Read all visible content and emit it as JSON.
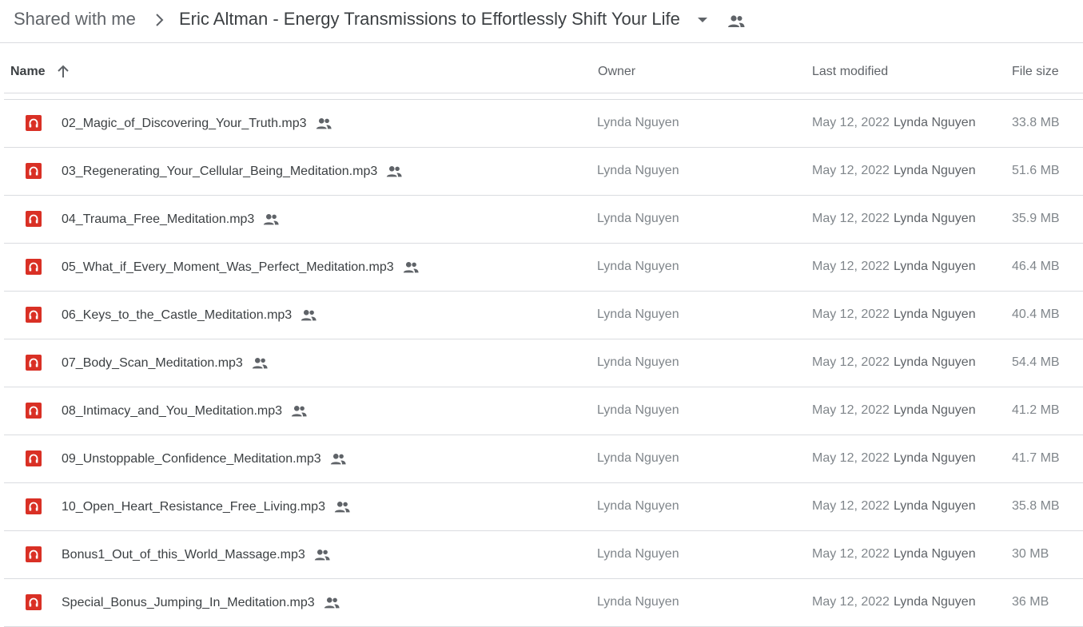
{
  "breadcrumb": {
    "root": "Shared with me",
    "folder": "Eric Altman - Energy Transmissions to Effortlessly Shift Your Life"
  },
  "columns": {
    "name": "Name",
    "owner": "Owner",
    "last_modified": "Last modified",
    "file_size": "File size"
  },
  "colors": {
    "audio_icon": "#d93025",
    "divider": "#dadce0",
    "muted_text": "#80868b"
  },
  "files": [
    {
      "name": "02_Magic_of_Discovering_Your_Truth.mp3",
      "owner": "Lynda Nguyen",
      "date": "May 12, 2022",
      "modified_by": "Lynda Nguyen",
      "size": "33.8 MB"
    },
    {
      "name": "03_Regenerating_Your_Cellular_Being_Meditation.mp3",
      "owner": "Lynda Nguyen",
      "date": "May 12, 2022",
      "modified_by": "Lynda Nguyen",
      "size": "51.6 MB"
    },
    {
      "name": "04_Trauma_Free_Meditation.mp3",
      "owner": "Lynda Nguyen",
      "date": "May 12, 2022",
      "modified_by": "Lynda Nguyen",
      "size": "35.9 MB"
    },
    {
      "name": "05_What_if_Every_Moment_Was_Perfect_Meditation.mp3",
      "owner": "Lynda Nguyen",
      "date": "May 12, 2022",
      "modified_by": "Lynda Nguyen",
      "size": "46.4 MB"
    },
    {
      "name": "06_Keys_to_the_Castle_Meditation.mp3",
      "owner": "Lynda Nguyen",
      "date": "May 12, 2022",
      "modified_by": "Lynda Nguyen",
      "size": "40.4 MB"
    },
    {
      "name": "07_Body_Scan_Meditation.mp3",
      "owner": "Lynda Nguyen",
      "date": "May 12, 2022",
      "modified_by": "Lynda Nguyen",
      "size": "54.4 MB"
    },
    {
      "name": "08_Intimacy_and_You_Meditation.mp3",
      "owner": "Lynda Nguyen",
      "date": "May 12, 2022",
      "modified_by": "Lynda Nguyen",
      "size": "41.2 MB"
    },
    {
      "name": "09_Unstoppable_Confidence_Meditation.mp3",
      "owner": "Lynda Nguyen",
      "date": "May 12, 2022",
      "modified_by": "Lynda Nguyen",
      "size": "41.7 MB"
    },
    {
      "name": "10_Open_Heart_Resistance_Free_Living.mp3",
      "owner": "Lynda Nguyen",
      "date": "May 12, 2022",
      "modified_by": "Lynda Nguyen",
      "size": "35.8 MB"
    },
    {
      "name": "Bonus1_Out_of_this_World_Massage.mp3",
      "owner": "Lynda Nguyen",
      "date": "May 12, 2022",
      "modified_by": "Lynda Nguyen",
      "size": "30 MB"
    },
    {
      "name": "Special_Bonus_Jumping_In_Meditation.mp3",
      "owner": "Lynda Nguyen",
      "date": "May 12, 2022",
      "modified_by": "Lynda Nguyen",
      "size": "36 MB"
    }
  ]
}
